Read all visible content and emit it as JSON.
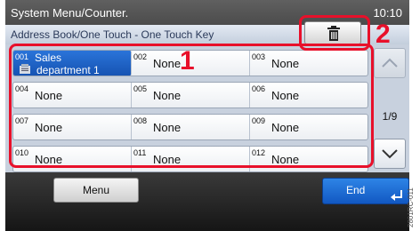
{
  "header": {
    "menu_title": "System Menu/Counter.",
    "clock": "10:10",
    "screen_title": "Address Book/One Touch - One Touch Key"
  },
  "toolbar": {
    "delete_icon": "trash-icon"
  },
  "keys": [
    [
      {
        "num": "001",
        "name": "Sales",
        "name2": "department 1",
        "selected": true,
        "icon": "address-book-icon"
      },
      {
        "num": "002",
        "name": "None"
      },
      {
        "num": "003",
        "name": "None"
      }
    ],
    [
      {
        "num": "004",
        "name": "None"
      },
      {
        "num": "005",
        "name": "None"
      },
      {
        "num": "006",
        "name": "None"
      }
    ],
    [
      {
        "num": "007",
        "name": "None"
      },
      {
        "num": "008",
        "name": "None"
      },
      {
        "num": "009",
        "name": "None"
      }
    ],
    [
      {
        "num": "010",
        "name": "None"
      },
      {
        "num": "011",
        "name": "None"
      },
      {
        "num": "012",
        "name": "None"
      }
    ]
  ],
  "pagination": {
    "indicator": "1/9",
    "up_icon": "chevron-up-icon",
    "down_icon": "chevron-down-icon"
  },
  "footer": {
    "menu_label": "Menu",
    "end_label": "End",
    "end_icon": "enter-arrow-icon"
  },
  "callouts": {
    "one": "1",
    "two": "2"
  },
  "side_code": "2801RC-011",
  "colors": {
    "accent": "#1e63cf",
    "callout": "#e8102a"
  }
}
